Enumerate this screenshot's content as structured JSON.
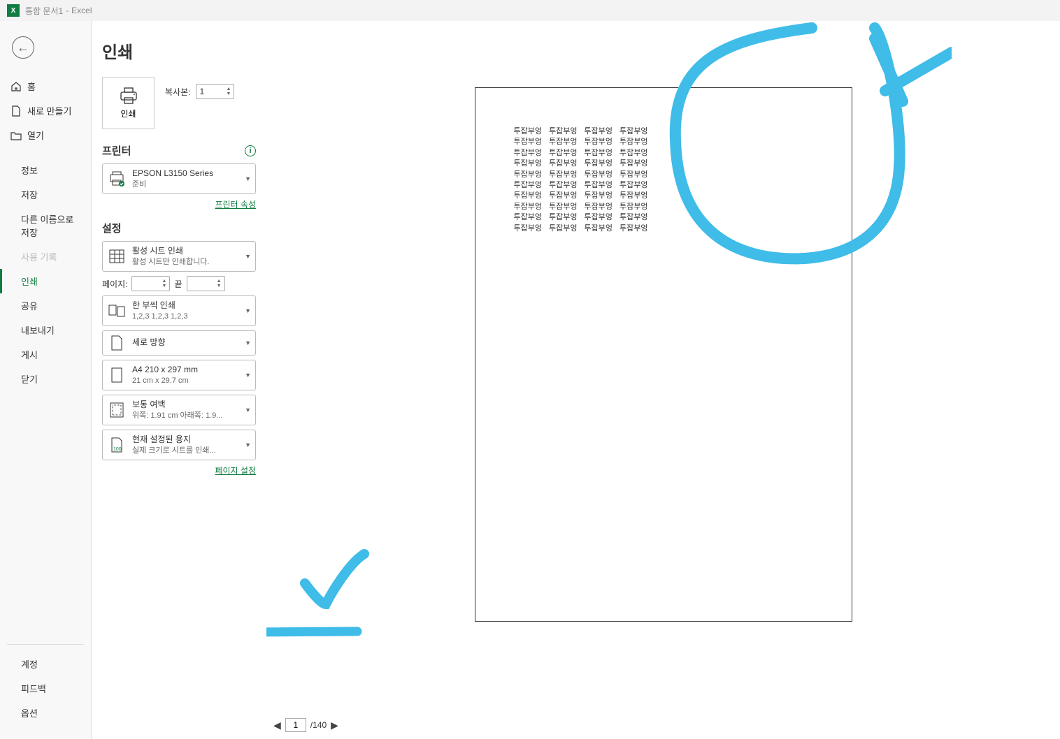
{
  "titlebar": {
    "app_icon_text": "X",
    "doc_name": "통합 문서1",
    "app_name": "Excel"
  },
  "nav": {
    "home": "홈",
    "new": "새로 만들기",
    "open": "열기",
    "info": "정보",
    "save": "저장",
    "save_as": "다른 이름으로 저장",
    "history": "사용 기록",
    "print": "인쇄",
    "share": "공유",
    "export": "내보내기",
    "publish": "게시",
    "close": "닫기",
    "account": "계정",
    "feedback": "피드백",
    "options": "옵션"
  },
  "print": {
    "title": "인쇄",
    "print_button": "인쇄",
    "copies_label": "복사본:",
    "copies_value": "1",
    "printer_head": "프린터",
    "printer_name": "EPSON L3150 Series",
    "printer_status": "준비",
    "printer_props": "프린터 속성",
    "settings_head": "설정",
    "active_sheets_title": "활성 시트 인쇄",
    "active_sheets_sub": "활성 시트만 인쇄합니다.",
    "pages_label": "페이지:",
    "pages_to": "끝",
    "collate_title": "한 부씩 인쇄",
    "collate_sub": "1,2,3    1,2,3    1,2,3",
    "orientation": "세로 방향",
    "paper_title": "A4 210 x 297 mm",
    "paper_sub": "21 cm x 29.7 cm",
    "margins_title": "보통 여백",
    "margins_sub": "위쪽: 1.91 cm 아래쪽: 1.9...",
    "scaling_title": "현재 설정된 용지",
    "scaling_sub": "실제 크기로 시트를 인쇄...",
    "page_setup": "페이지 설정"
  },
  "preview": {
    "cell_text": "투잡부엉",
    "rows": 10,
    "cols": 4,
    "current_page": "1",
    "total_pages": "140"
  }
}
